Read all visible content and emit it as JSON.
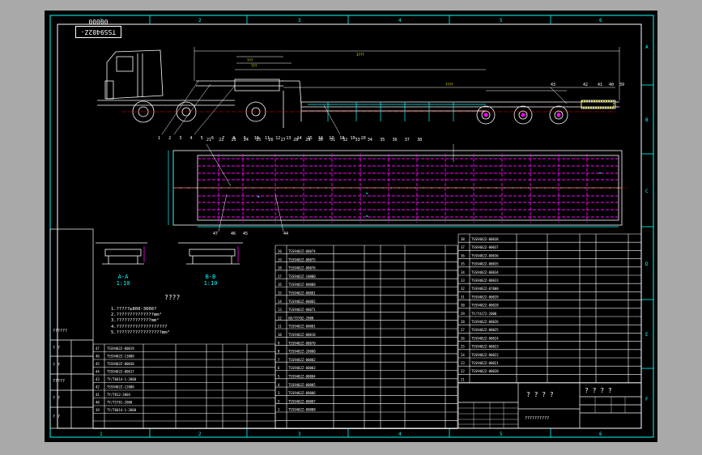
{
  "drawing_tag": "TSS9402Z-00000",
  "notes": {
    "title": "????",
    "lines": [
      "1.?????≥800-3000?",
      "2.??????????????mm²",
      "3.?????????????mm²",
      "4.???????????????????",
      "5.?????????????????mm²"
    ]
  },
  "sections": {
    "a_label": "A-A",
    "a_scale": "1:10",
    "b_label": "B-B",
    "b_scale": "1:10"
  },
  "title_block": {
    "name_left": "? ? ? ?",
    "name_right": "? ? ? ?",
    "scale_text": "??????????"
  },
  "balloons_top": [
    "1",
    "2",
    "3",
    "4",
    "5",
    "6",
    "7",
    "8",
    "9",
    "10",
    "11",
    "12",
    "13",
    "14",
    "15",
    "16",
    "17",
    "18",
    "19",
    "20"
  ],
  "balloons_mid": [
    "21",
    "22",
    "23",
    "24",
    "25",
    "26",
    "27",
    "28",
    "29",
    "30",
    "31",
    "32",
    "33",
    "34",
    "35",
    "36",
    "37",
    "38"
  ],
  "balloons_right": [
    "43",
    "42",
    "41",
    "40",
    "39"
  ],
  "balloons_bottom": [
    "47",
    "46",
    "45",
    "44"
  ],
  "col_numbers": [
    "1",
    "2",
    "3",
    "4",
    "5",
    "6"
  ],
  "row_letters": [
    "A",
    "B",
    "C",
    "D",
    "E",
    "F"
  ],
  "left_strip": [
    "??????",
    "? ?",
    "? ?",
    "?????",
    "? ?",
    "? ?"
  ],
  "table_left_codes": [
    "TSS9402Z-00019",
    "TSS9402Z-13000",
    "TSS9402Z-00030",
    "TSS9402Z-00017",
    "TY/T6014-1-2000",
    "TSS9402Z-12000",
    "TY/T812-2004",
    "TY/T5781-2000",
    "TY/T6014-1-2000"
  ],
  "table_left_nums": [
    "47",
    "46",
    "45",
    "44",
    "43",
    "42",
    "41",
    "40",
    "39"
  ],
  "table_mid_codes": [
    "TSS9402Z-00074",
    "TSS9402Z-00075",
    "TSS9402Z-00076",
    "TSS9402Z-10000",
    "TSS9402Z-00080",
    "TSS9402Z-00081",
    "TSS9402Z-00082",
    "TSS9402Z-00071",
    "GB/T5782-2000",
    "TSS9402Z-00001",
    "TSS9402Z-00018",
    "TSS9402Z-00070",
    "TSS9402Z-20000",
    "TSS9402Z-00002",
    "TSS9402Z-00003",
    "TSS9402Z-00004",
    "TSS9402Z-00005",
    "TSS9402Z-00006",
    "TSS9402Z-00007",
    "TSS9402Z-00008",
    "TSS9402Z-00009"
  ],
  "table_mid_nums": [
    "20",
    "19",
    "18",
    "17",
    "16",
    "15",
    "14",
    "13",
    "12",
    "11",
    "10",
    "9",
    "8",
    "7",
    "6",
    "5",
    "4",
    "3",
    "2",
    "1"
  ],
  "table_right_codes": [
    "TSS9402Z-00038",
    "TSS9402Z-00037",
    "TSS9402Z-00036",
    "TSS9402Z-00035",
    "TSS9402Z-00034",
    "TSS9402Z-00033",
    "TSS9402Z-07000",
    "TSS9402Z-00029",
    "TSS9402Z-00028",
    "TY/T4172-2000",
    "TSS9402Z-00026",
    "TSS9402Z-00025",
    "TSS9402Z-00024",
    "TSS9402Z-00023",
    "TSS9402Z-00022",
    "TSS9402Z-00021",
    "TSS9402Z-00020"
  ],
  "table_right_nums": [
    "38",
    "37",
    "36",
    "35",
    "34",
    "33",
    "32",
    "31",
    "30",
    "29",
    "28",
    "27",
    "26",
    "25",
    "24",
    "23",
    "22",
    "21"
  ]
}
